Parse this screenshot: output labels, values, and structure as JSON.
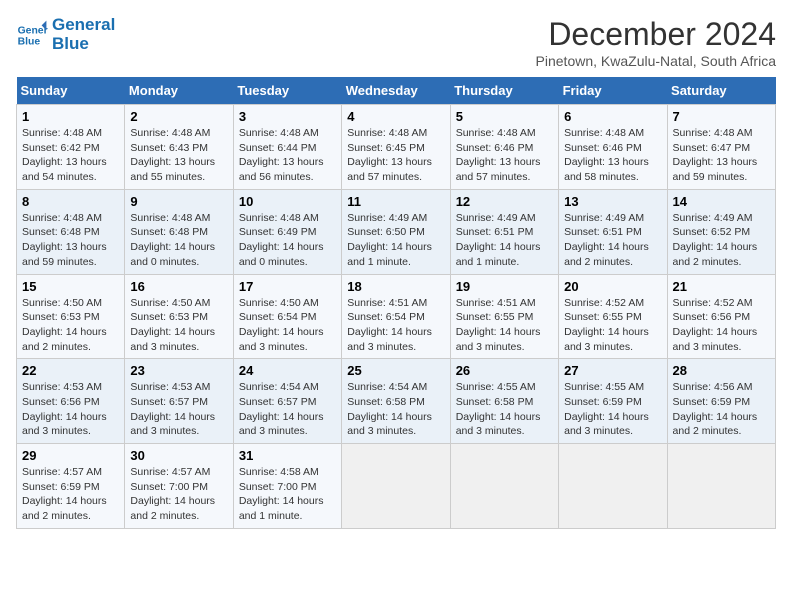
{
  "logo": {
    "line1": "General",
    "line2": "Blue"
  },
  "title": "December 2024",
  "location": "Pinetown, KwaZulu-Natal, South Africa",
  "weekdays": [
    "Sunday",
    "Monday",
    "Tuesday",
    "Wednesday",
    "Thursday",
    "Friday",
    "Saturday"
  ],
  "weeks": [
    [
      {
        "day": "1",
        "info": "Sunrise: 4:48 AM\nSunset: 6:42 PM\nDaylight: 13 hours\nand 54 minutes."
      },
      {
        "day": "2",
        "info": "Sunrise: 4:48 AM\nSunset: 6:43 PM\nDaylight: 13 hours\nand 55 minutes."
      },
      {
        "day": "3",
        "info": "Sunrise: 4:48 AM\nSunset: 6:44 PM\nDaylight: 13 hours\nand 56 minutes."
      },
      {
        "day": "4",
        "info": "Sunrise: 4:48 AM\nSunset: 6:45 PM\nDaylight: 13 hours\nand 57 minutes."
      },
      {
        "day": "5",
        "info": "Sunrise: 4:48 AM\nSunset: 6:46 PM\nDaylight: 13 hours\nand 57 minutes."
      },
      {
        "day": "6",
        "info": "Sunrise: 4:48 AM\nSunset: 6:46 PM\nDaylight: 13 hours\nand 58 minutes."
      },
      {
        "day": "7",
        "info": "Sunrise: 4:48 AM\nSunset: 6:47 PM\nDaylight: 13 hours\nand 59 minutes."
      }
    ],
    [
      {
        "day": "8",
        "info": "Sunrise: 4:48 AM\nSunset: 6:48 PM\nDaylight: 13 hours\nand 59 minutes."
      },
      {
        "day": "9",
        "info": "Sunrise: 4:48 AM\nSunset: 6:48 PM\nDaylight: 14 hours\nand 0 minutes."
      },
      {
        "day": "10",
        "info": "Sunrise: 4:48 AM\nSunset: 6:49 PM\nDaylight: 14 hours\nand 0 minutes."
      },
      {
        "day": "11",
        "info": "Sunrise: 4:49 AM\nSunset: 6:50 PM\nDaylight: 14 hours\nand 1 minute."
      },
      {
        "day": "12",
        "info": "Sunrise: 4:49 AM\nSunset: 6:51 PM\nDaylight: 14 hours\nand 1 minute."
      },
      {
        "day": "13",
        "info": "Sunrise: 4:49 AM\nSunset: 6:51 PM\nDaylight: 14 hours\nand 2 minutes."
      },
      {
        "day": "14",
        "info": "Sunrise: 4:49 AM\nSunset: 6:52 PM\nDaylight: 14 hours\nand 2 minutes."
      }
    ],
    [
      {
        "day": "15",
        "info": "Sunrise: 4:50 AM\nSunset: 6:53 PM\nDaylight: 14 hours\nand 2 minutes."
      },
      {
        "day": "16",
        "info": "Sunrise: 4:50 AM\nSunset: 6:53 PM\nDaylight: 14 hours\nand 3 minutes."
      },
      {
        "day": "17",
        "info": "Sunrise: 4:50 AM\nSunset: 6:54 PM\nDaylight: 14 hours\nand 3 minutes."
      },
      {
        "day": "18",
        "info": "Sunrise: 4:51 AM\nSunset: 6:54 PM\nDaylight: 14 hours\nand 3 minutes."
      },
      {
        "day": "19",
        "info": "Sunrise: 4:51 AM\nSunset: 6:55 PM\nDaylight: 14 hours\nand 3 minutes."
      },
      {
        "day": "20",
        "info": "Sunrise: 4:52 AM\nSunset: 6:55 PM\nDaylight: 14 hours\nand 3 minutes."
      },
      {
        "day": "21",
        "info": "Sunrise: 4:52 AM\nSunset: 6:56 PM\nDaylight: 14 hours\nand 3 minutes."
      }
    ],
    [
      {
        "day": "22",
        "info": "Sunrise: 4:53 AM\nSunset: 6:56 PM\nDaylight: 14 hours\nand 3 minutes."
      },
      {
        "day": "23",
        "info": "Sunrise: 4:53 AM\nSunset: 6:57 PM\nDaylight: 14 hours\nand 3 minutes."
      },
      {
        "day": "24",
        "info": "Sunrise: 4:54 AM\nSunset: 6:57 PM\nDaylight: 14 hours\nand 3 minutes."
      },
      {
        "day": "25",
        "info": "Sunrise: 4:54 AM\nSunset: 6:58 PM\nDaylight: 14 hours\nand 3 minutes."
      },
      {
        "day": "26",
        "info": "Sunrise: 4:55 AM\nSunset: 6:58 PM\nDaylight: 14 hours\nand 3 minutes."
      },
      {
        "day": "27",
        "info": "Sunrise: 4:55 AM\nSunset: 6:59 PM\nDaylight: 14 hours\nand 3 minutes."
      },
      {
        "day": "28",
        "info": "Sunrise: 4:56 AM\nSunset: 6:59 PM\nDaylight: 14 hours\nand 2 minutes."
      }
    ],
    [
      {
        "day": "29",
        "info": "Sunrise: 4:57 AM\nSunset: 6:59 PM\nDaylight: 14 hours\nand 2 minutes."
      },
      {
        "day": "30",
        "info": "Sunrise: 4:57 AM\nSunset: 7:00 PM\nDaylight: 14 hours\nand 2 minutes."
      },
      {
        "day": "31",
        "info": "Sunrise: 4:58 AM\nSunset: 7:00 PM\nDaylight: 14 hours\nand 1 minute."
      },
      {
        "day": "",
        "info": ""
      },
      {
        "day": "",
        "info": ""
      },
      {
        "day": "",
        "info": ""
      },
      {
        "day": "",
        "info": ""
      }
    ]
  ]
}
